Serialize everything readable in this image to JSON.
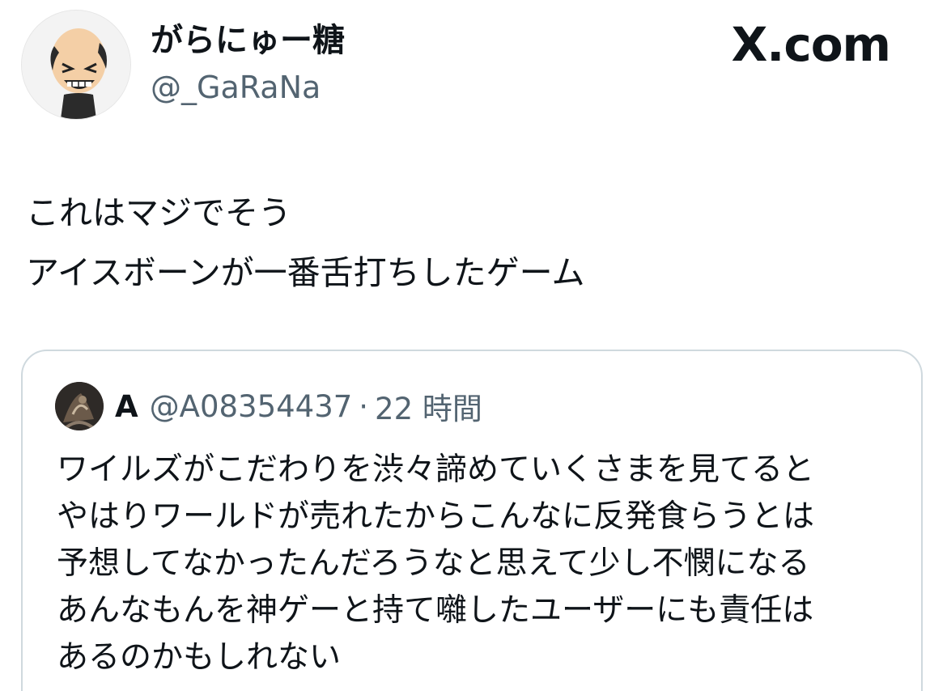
{
  "author": {
    "display_name": "がらにゅー糖",
    "handle": "@_GaRaNa",
    "avatar_icon": "bald-cartoon-avatar-icon"
  },
  "brand": {
    "label": "X.com"
  },
  "tweet": {
    "lines": [
      "これはマジでそう",
      "アイスボーンが一番舌打ちしたゲーム"
    ]
  },
  "quote": {
    "avatar_icon": "dark-photo-avatar-icon",
    "name": "A",
    "handle": "@A08354437",
    "separator": "·",
    "time": "22 時間",
    "lines": [
      "ワイルズがこだわりを渋々諦めていくさまを見てると",
      "やはりワールドが売れたからこんなに反発食らうとは",
      "予想してなかったんだろうなと思えて少し不憫になる",
      "あんなもんを神ゲーと持て囃したユーザーにも責任は",
      "あるのかもしれない"
    ]
  },
  "colors": {
    "text_primary": "#0f1419",
    "text_secondary": "#536471",
    "card_border": "#cfd9de",
    "background": "#ffffff"
  }
}
